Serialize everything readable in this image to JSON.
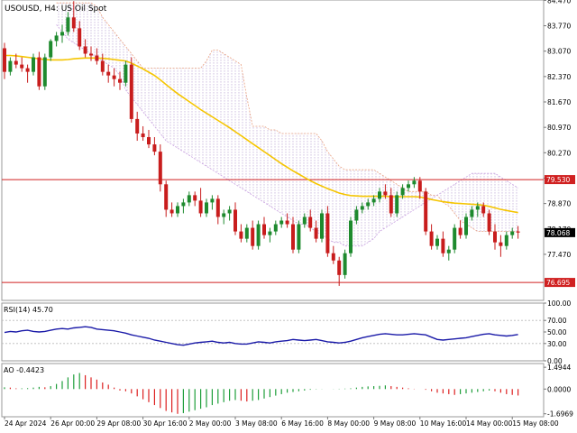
{
  "chart_data": [
    {
      "type": "candlestick",
      "panel": "main",
      "title": "USOUSD, H4:  US Oil Spot",
      "ylim": [
        76.2,
        84.48
      ],
      "y_ticks": [
        "84.470",
        "83.770",
        "83.070",
        "82.370",
        "81.670",
        "80.970",
        "80.270",
        "79.570",
        "78.870",
        "78.170",
        "77.470"
      ],
      "y_tick_values": [
        84.47,
        83.77,
        83.07,
        82.37,
        81.67,
        80.97,
        80.27,
        79.57,
        78.87,
        78.17,
        77.47
      ],
      "x_ticks": [
        "24 Apr 2024",
        "26 Apr 00:00",
        "29 Apr 08:00",
        "30 Apr 16:00",
        "2 May 00:00",
        "3 May 08:00",
        "6 May 16:00",
        "8 May 00:00",
        "9 May 08:00",
        "10 May 16:00",
        "14 May 00:00",
        "15 May 08:00"
      ],
      "x_tick_bars": [
        0,
        8,
        16,
        24,
        32,
        40,
        48,
        56,
        64,
        72,
        80,
        88
      ],
      "bar_count": 90,
      "levels": [
        {
          "label": "79.530",
          "value": 79.53,
          "color": "#d02020"
        },
        {
          "label": "76.695",
          "value": 76.695,
          "color": "#d02020"
        }
      ],
      "current_price": {
        "label": "78.068",
        "value": 78.068
      },
      "candles": [
        [
          83.15,
          83.3,
          82.3,
          82.5
        ],
        [
          82.5,
          82.9,
          82.4,
          82.8
        ],
        [
          82.8,
          83.0,
          82.6,
          82.7
        ],
        [
          82.7,
          82.9,
          82.5,
          82.6
        ],
        [
          82.6,
          82.7,
          82.2,
          82.5
        ],
        [
          82.5,
          83.0,
          82.4,
          82.9
        ],
        [
          82.9,
          83.05,
          82.0,
          82.1
        ],
        [
          82.1,
          83.0,
          82.0,
          82.9
        ],
        [
          82.9,
          83.4,
          82.8,
          83.35
        ],
        [
          83.35,
          83.6,
          83.2,
          83.5
        ],
        [
          83.5,
          83.8,
          83.3,
          83.6
        ],
        [
          83.6,
          84.15,
          83.5,
          84.0
        ],
        [
          84.0,
          84.45,
          83.6,
          83.7
        ],
        [
          83.7,
          83.9,
          83.1,
          83.2
        ],
        [
          83.2,
          83.4,
          82.9,
          83.0
        ],
        [
          83.0,
          83.2,
          82.8,
          82.95
        ],
        [
          82.95,
          83.15,
          82.7,
          82.8
        ],
        [
          82.8,
          83.0,
          82.4,
          82.5
        ],
        [
          82.5,
          82.7,
          82.2,
          82.4
        ],
        [
          82.4,
          82.6,
          82.1,
          82.3
        ],
        [
          82.3,
          82.5,
          82.0,
          82.2
        ],
        [
          82.2,
          82.8,
          82.1,
          82.7
        ],
        [
          82.7,
          82.9,
          81.1,
          81.2
        ],
        [
          81.2,
          81.4,
          80.6,
          80.8
        ],
        [
          80.8,
          81.0,
          80.6,
          80.7
        ],
        [
          80.7,
          80.9,
          80.4,
          80.5
        ],
        [
          80.5,
          80.7,
          80.2,
          80.3
        ],
        [
          80.3,
          80.5,
          79.2,
          79.4
        ],
        [
          79.4,
          79.5,
          78.5,
          78.7
        ],
        [
          78.7,
          78.9,
          78.5,
          78.6
        ],
        [
          78.6,
          78.9,
          78.5,
          78.8
        ],
        [
          78.8,
          79.0,
          78.6,
          78.9
        ],
        [
          78.9,
          79.2,
          78.8,
          79.1
        ],
        [
          79.1,
          79.2,
          78.8,
          78.95
        ],
        [
          78.95,
          79.3,
          78.5,
          78.6
        ],
        [
          78.6,
          79.0,
          78.5,
          78.9
        ],
        [
          78.9,
          79.1,
          78.7,
          79.0
        ],
        [
          79.0,
          79.1,
          78.3,
          78.5
        ],
        [
          78.5,
          78.7,
          78.3,
          78.6
        ],
        [
          78.6,
          78.8,
          78.4,
          78.7
        ],
        [
          78.7,
          78.9,
          78.0,
          78.1
        ],
        [
          78.1,
          78.3,
          77.8,
          77.9
        ],
        [
          77.9,
          78.3,
          77.8,
          78.2
        ],
        [
          78.2,
          78.4,
          77.6,
          77.7
        ],
        [
          77.7,
          78.4,
          77.6,
          78.3
        ],
        [
          78.3,
          78.5,
          77.9,
          78.0
        ],
        [
          78.0,
          78.2,
          77.8,
          78.1
        ],
        [
          78.1,
          78.4,
          78.0,
          78.3
        ],
        [
          78.3,
          78.5,
          78.2,
          78.4
        ],
        [
          78.4,
          78.6,
          78.2,
          78.3
        ],
        [
          78.3,
          78.5,
          77.5,
          77.6
        ],
        [
          77.6,
          78.4,
          77.5,
          78.3
        ],
        [
          78.3,
          78.6,
          78.2,
          78.5
        ],
        [
          78.5,
          78.7,
          78.1,
          78.2
        ],
        [
          78.2,
          78.4,
          77.8,
          77.9
        ],
        [
          77.9,
          78.7,
          77.8,
          78.6
        ],
        [
          78.6,
          78.8,
          77.4,
          77.5
        ],
        [
          77.5,
          77.7,
          77.2,
          77.3
        ],
        [
          77.3,
          77.4,
          76.6,
          76.9
        ],
        [
          76.9,
          77.6,
          76.8,
          77.5
        ],
        [
          77.5,
          78.5,
          77.4,
          78.4
        ],
        [
          78.4,
          78.8,
          78.3,
          78.7
        ],
        [
          78.7,
          78.9,
          78.6,
          78.8
        ],
        [
          78.8,
          79.0,
          78.7,
          78.9
        ],
        [
          78.9,
          79.1,
          78.8,
          79.0
        ],
        [
          79.0,
          79.3,
          78.9,
          79.2
        ],
        [
          79.2,
          79.4,
          79.0,
          79.1
        ],
        [
          79.1,
          79.3,
          78.5,
          78.6
        ],
        [
          78.6,
          79.2,
          78.5,
          79.1
        ],
        [
          79.1,
          79.4,
          79.0,
          79.3
        ],
        [
          79.3,
          79.5,
          79.2,
          79.4
        ],
        [
          79.4,
          79.6,
          79.3,
          79.5
        ],
        [
          79.5,
          79.6,
          79.0,
          79.2
        ],
        [
          79.2,
          79.3,
          78.0,
          78.1
        ],
        [
          78.1,
          78.3,
          77.6,
          77.7
        ],
        [
          77.7,
          78.0,
          77.6,
          77.9
        ],
        [
          77.9,
          78.1,
          77.4,
          77.5
        ],
        [
          77.5,
          77.7,
          77.3,
          77.6
        ],
        [
          77.6,
          78.3,
          77.5,
          78.2
        ],
        [
          78.2,
          78.4,
          77.9,
          78.0
        ],
        [
          78.0,
          78.6,
          77.9,
          78.5
        ],
        [
          78.5,
          78.8,
          78.4,
          78.7
        ],
        [
          78.7,
          78.9,
          78.5,
          78.8
        ],
        [
          78.8,
          78.9,
          78.5,
          78.6
        ],
        [
          78.6,
          78.7,
          78.0,
          78.1
        ],
        [
          78.1,
          78.3,
          77.6,
          77.8
        ],
        [
          77.8,
          78.0,
          77.4,
          77.7
        ],
        [
          77.7,
          78.1,
          77.6,
          78.0
        ],
        [
          78.0,
          78.2,
          77.9,
          78.1
        ],
        [
          78.1,
          78.25,
          77.9,
          78.07
        ]
      ],
      "ma": {
        "color": "#f5c500",
        "values": [
          82.95,
          82.95,
          82.94,
          82.92,
          82.9,
          82.88,
          82.86,
          82.84,
          82.83,
          82.83,
          82.83,
          82.84,
          82.86,
          82.87,
          82.88,
          82.88,
          82.88,
          82.87,
          82.86,
          82.84,
          82.82,
          82.8,
          82.74,
          82.66,
          82.58,
          82.49,
          82.4,
          82.28,
          82.15,
          82.02,
          81.9,
          81.79,
          81.68,
          81.57,
          81.46,
          81.36,
          81.26,
          81.16,
          81.06,
          80.96,
          80.85,
          80.74,
          80.63,
          80.52,
          80.41,
          80.3,
          80.19,
          80.08,
          79.97,
          79.87,
          79.77,
          79.68,
          79.59,
          79.5,
          79.42,
          79.35,
          79.28,
          79.22,
          79.16,
          79.12,
          79.09,
          79.08,
          79.07,
          79.07,
          79.07,
          79.07,
          79.07,
          79.06,
          79.06,
          79.06,
          79.06,
          79.06,
          79.05,
          79.02,
          78.98,
          78.95,
          78.92,
          78.9,
          78.88,
          78.87,
          78.86,
          78.85,
          78.84,
          78.82,
          78.79,
          78.75,
          78.71,
          78.68,
          78.65,
          78.62
        ]
      },
      "cloud": {
        "offset_bars": 9,
        "upper": [
          84.4,
          84.4,
          84.4,
          84.4,
          84.4,
          84.4,
          84.4,
          84.3,
          84.0,
          83.8,
          83.6,
          83.4,
          83.2,
          83.0,
          82.8,
          82.6,
          82.6,
          82.6,
          82.6,
          82.6,
          82.6,
          82.6,
          82.6,
          82.6,
          82.6,
          82.6,
          82.8,
          83.1,
          83.1,
          83.0,
          82.9,
          82.8,
          82.7,
          81.8,
          81.0,
          81.0,
          81.0,
          80.9,
          80.9,
          80.8,
          80.8,
          80.8,
          80.8,
          80.8,
          80.8,
          80.8,
          80.6,
          80.3,
          80.1,
          79.9,
          79.8,
          79.8,
          79.8,
          79.8,
          79.8,
          79.8,
          79.7,
          79.6,
          79.5,
          79.4,
          79.3,
          79.2,
          79.2,
          79.2,
          79.2,
          79.1,
          79.1,
          78.9,
          78.8,
          78.6,
          78.4,
          78.3,
          78.2,
          78.1,
          78.1,
          78.1,
          78.1,
          78.1,
          78.1,
          78.1,
          78.1
        ],
        "lower": [
          83.8,
          83.6,
          83.4,
          83.3,
          83.2,
          83.1,
          83.0,
          82.9,
          82.8,
          82.7,
          82.6,
          82.4,
          82.0,
          81.8,
          81.6,
          81.4,
          81.2,
          81.0,
          80.8,
          80.6,
          80.5,
          80.4,
          80.3,
          80.2,
          80.1,
          80.0,
          79.9,
          79.8,
          79.7,
          79.6,
          79.5,
          79.4,
          79.3,
          79.2,
          79.1,
          79.0,
          78.9,
          78.8,
          78.7,
          78.6,
          78.5,
          78.4,
          78.3,
          78.3,
          78.2,
          78.1,
          78.0,
          77.9,
          77.8,
          77.8,
          77.7,
          77.7,
          77.7,
          77.7,
          77.8,
          77.9,
          78.1,
          78.2,
          78.3,
          78.4,
          78.5,
          78.6,
          78.7,
          78.8,
          78.9,
          79.0,
          79.1,
          79.2,
          79.3,
          79.4,
          79.5,
          79.6,
          79.7,
          79.7,
          79.7,
          79.7,
          79.7,
          79.6,
          79.5,
          79.4,
          79.3
        ]
      },
      "colors": {
        "bull": "#1e8a2e",
        "bear": "#c81d1d",
        "grid": "#d8dbe0",
        "cloud_upper": "#e8a080",
        "cloud_lower": "#c8a0e0",
        "hatch": "#c4b0d8"
      }
    },
    {
      "type": "line",
      "panel": "rsi",
      "title": "RSI(14) 45.70",
      "ylim": [
        0,
        100
      ],
      "y_ticks": [
        "100.00",
        "70.00",
        "50.00",
        "30.00",
        "0.00"
      ],
      "y_tick_values": [
        100,
        70,
        50,
        30,
        0
      ],
      "levels": [
        70,
        30
      ],
      "series": [
        {
          "color": "#1a1aa8",
          "values": [
            49,
            51,
            50,
            52,
            53,
            51,
            50,
            51,
            53,
            55,
            56,
            55,
            57,
            58,
            59,
            58,
            55,
            54,
            53,
            52,
            50,
            48,
            45,
            43,
            41,
            39,
            36,
            34,
            32,
            30,
            28,
            27,
            29,
            31,
            32,
            33,
            34,
            32,
            31,
            32,
            30,
            29,
            29,
            31,
            33,
            32,
            31,
            33,
            34,
            35,
            37,
            36,
            35,
            36,
            37,
            35,
            33,
            32,
            31,
            32,
            34,
            37,
            40,
            42,
            44,
            46,
            47,
            46,
            45,
            45,
            46,
            47,
            46,
            45,
            41,
            37,
            36,
            37,
            38,
            39,
            40,
            42,
            44,
            46,
            47,
            45,
            44,
            43,
            44,
            45.7
          ]
        }
      ]
    },
    {
      "type": "bar",
      "panel": "ao",
      "title": "AO -0.4423",
      "ylim": [
        -1.9,
        1.75
      ],
      "y_ticks": [
        "1.4944",
        "0.0000",
        "-1.6969"
      ],
      "y_tick_values": [
        1.4944,
        0,
        -1.6969
      ],
      "values": [
        0.12,
        0.1,
        0.05,
        0.05,
        0.06,
        0.1,
        0.15,
        0.12,
        0.2,
        0.35,
        0.55,
        0.8,
        1.0,
        1.1,
        0.95,
        0.8,
        0.65,
        0.45,
        0.3,
        0.1,
        -0.1,
        -0.15,
        -0.3,
        -0.5,
        -0.7,
        -0.9,
        -1.1,
        -1.3,
        -1.5,
        -1.6,
        -1.7,
        -1.65,
        -1.55,
        -1.45,
        -1.35,
        -1.25,
        -1.1,
        -1.0,
        -0.9,
        -0.8,
        -0.75,
        -0.8,
        -0.85,
        -0.8,
        -0.75,
        -0.65,
        -0.55,
        -0.45,
        -0.35,
        -0.25,
        -0.2,
        -0.15,
        -0.1,
        -0.05,
        -0.02,
        -0.01,
        0.0,
        0.01,
        0.02,
        0.03,
        0.05,
        0.1,
        0.15,
        0.18,
        0.2,
        0.22,
        0.25,
        0.2,
        0.15,
        0.1,
        0.05,
        0.02,
        0.0,
        -0.05,
        -0.15,
        -0.25,
        -0.3,
        -0.35,
        -0.4,
        -0.35,
        -0.3,
        -0.25,
        -0.2,
        -0.15,
        -0.1,
        -0.15,
        -0.25,
        -0.35,
        -0.4,
        -0.4423
      ],
      "colors": {
        "up": "#1e9e3a",
        "down": "#dd2020"
      }
    }
  ]
}
